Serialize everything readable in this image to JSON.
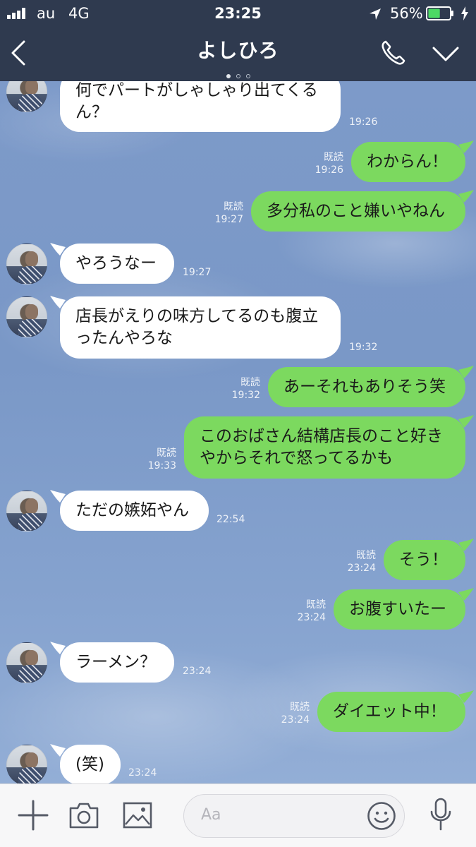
{
  "status_bar": {
    "carrier": "au",
    "network": "4G",
    "time": "23:25",
    "battery": "56%",
    "battery_level": 0.56
  },
  "header": {
    "title": "よしひろ",
    "page_dots": 3,
    "active_dot": 0
  },
  "colors": {
    "header_bg": "#2f3a4f",
    "outgoing_bubble": "#7cd95f",
    "incoming_bubble": "#ffffff",
    "chat_bg": "#7d9ac9"
  },
  "messages": [
    {
      "side": "in",
      "text": "何でパートがしゃしゃり出てくる\nん？",
      "time": "19:26",
      "read": ""
    },
    {
      "side": "out",
      "text": "わからん！",
      "time": "19:26",
      "read": "既読"
    },
    {
      "side": "out",
      "text": "多分私のこと嫌いやねん",
      "time": "19:27",
      "read": "既読"
    },
    {
      "side": "in",
      "text": "やろうなー",
      "time": "19:27",
      "read": ""
    },
    {
      "side": "in",
      "text": "店長がえりの味方してるのも腹立\nったんやろな",
      "time": "19:32",
      "read": ""
    },
    {
      "side": "out",
      "text": "あーそれもありそう笑",
      "time": "19:32",
      "read": "既読"
    },
    {
      "side": "out",
      "text": "このおばさん結構店長のこと好き\nやからそれで怒ってるかも",
      "time": "19:33",
      "read": "既読"
    },
    {
      "side": "in",
      "text": "ただの嫉妬やん",
      "time": "22:54",
      "read": ""
    },
    {
      "side": "out",
      "text": "そう！",
      "time": "23:24",
      "read": "既読"
    },
    {
      "side": "out",
      "text": "お腹すいたー",
      "time": "23:24",
      "read": "既読"
    },
    {
      "side": "in",
      "text": "ラーメン？",
      "time": "23:24",
      "read": ""
    },
    {
      "side": "out",
      "text": "ダイエット中！",
      "time": "23:24",
      "read": "既読"
    },
    {
      "side": "in",
      "text": "(笑)",
      "time": "23:24",
      "read": ""
    }
  ],
  "footer": {
    "input_placeholder": "Aa",
    "icons": [
      "plus-icon",
      "camera-icon",
      "image-icon",
      "emoji-icon",
      "mic-icon"
    ]
  }
}
